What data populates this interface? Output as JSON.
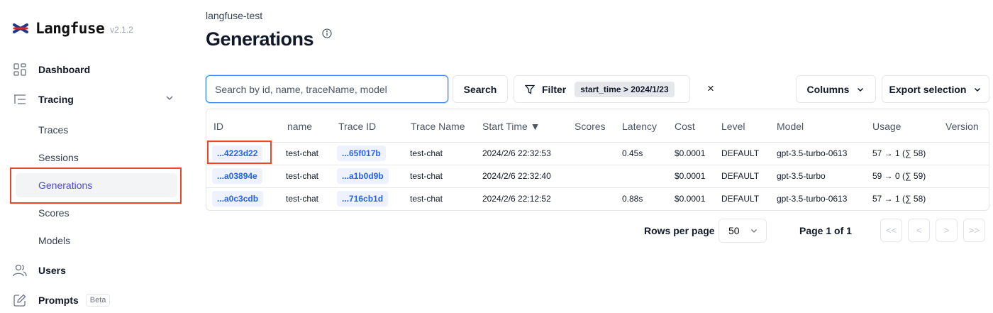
{
  "app": {
    "name": "Langfuse",
    "version": "v2.1.2"
  },
  "sidebar": {
    "dashboard": "Dashboard",
    "tracing": "Tracing",
    "tracing_items": [
      "Traces",
      "Sessions",
      "Generations",
      "Scores",
      "Models"
    ],
    "users": "Users",
    "prompts": "Prompts",
    "prompts_badge": "Beta"
  },
  "header": {
    "breadcrumb": "langfuse-test",
    "title": "Generations"
  },
  "toolbar": {
    "search_placeholder": "Search by id, name, traceName, model",
    "search_button": "Search",
    "filter_label": "Filter",
    "filter_chip": "start_time > 2024/1/23",
    "clear_label": "×",
    "columns_label": "Columns",
    "export_label": "Export selection"
  },
  "table": {
    "columns": [
      "ID",
      "name",
      "Trace ID",
      "Trace Name",
      "Start Time ▼",
      "Scores",
      "Latency",
      "Cost",
      "Level",
      "Model",
      "Usage",
      "Version"
    ],
    "rows": [
      {
        "id": "...4223d22",
        "name": "test-chat",
        "trace_id": "...65f017b",
        "trace_name": "test-chat",
        "start_time": "2024/2/6 22:32:53",
        "scores": "",
        "latency": "0.45s",
        "cost": "$0.0001",
        "level": "DEFAULT",
        "model": "gpt-3.5-turbo-0613",
        "usage": "57 → 1 (∑ 58)",
        "version": ""
      },
      {
        "id": "...a03894e",
        "name": "test-chat",
        "trace_id": "...a1b0d9b",
        "trace_name": "test-chat",
        "start_time": "2024/2/6 22:32:40",
        "scores": "",
        "latency": "",
        "cost": "$0.0001",
        "level": "DEFAULT",
        "model": "gpt-3.5-turbo",
        "usage": "59 → 0 (∑ 59)",
        "version": ""
      },
      {
        "id": "...a0c3cdb",
        "name": "test-chat",
        "trace_id": "...716cb1d",
        "trace_name": "test-chat",
        "start_time": "2024/2/6 22:12:52",
        "scores": "",
        "latency": "0.88s",
        "cost": "$0.0001",
        "level": "DEFAULT",
        "model": "gpt-3.5-turbo-0613",
        "usage": "57 → 1 (∑ 58)",
        "version": ""
      }
    ]
  },
  "pagination": {
    "rows_per_page_label": "Rows per page",
    "rows_per_page": "50",
    "page_info": "Page 1 of 1",
    "first": "<<",
    "prev": "<",
    "next": ">",
    "last": ">>"
  },
  "colors": {
    "accent": "#4f46e5",
    "link": "#2563eb",
    "highlight": "#ef4426"
  }
}
